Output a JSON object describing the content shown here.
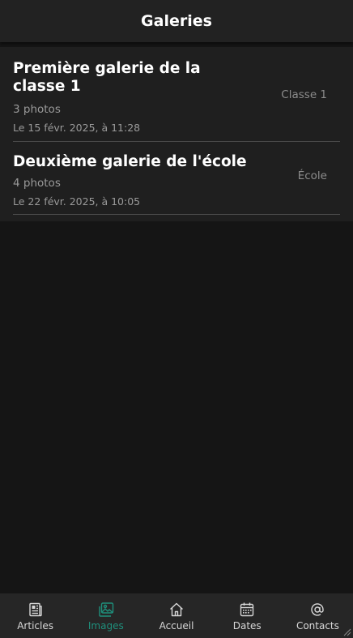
{
  "header": {
    "title": "Galeries"
  },
  "galleries": [
    {
      "title": "Première galerie de la classe 1",
      "count": "3 photos",
      "date": "Le 15 févr. 2025, à 11:28",
      "tag": "Classe 1"
    },
    {
      "title": "Deuxième galerie de l'école",
      "count": "4 photos",
      "date": "Le 22 févr. 2025, à 10:05",
      "tag": "École"
    }
  ],
  "tabs": [
    {
      "label": "Articles",
      "icon": "newspaper-icon",
      "active": false
    },
    {
      "label": "Images",
      "icon": "image-icon",
      "active": true
    },
    {
      "label": "Accueil",
      "icon": "home-icon",
      "active": false
    },
    {
      "label": "Dates",
      "icon": "calendar-icon",
      "active": false
    },
    {
      "label": "Contacts",
      "icon": "at-icon",
      "active": false
    }
  ],
  "colors": {
    "background": "#151515",
    "header": "#222222",
    "list": "#1f1f1f",
    "tabbar": "#262626",
    "accent": "#1f8f7c",
    "muted_text": "#9a9a9a"
  }
}
